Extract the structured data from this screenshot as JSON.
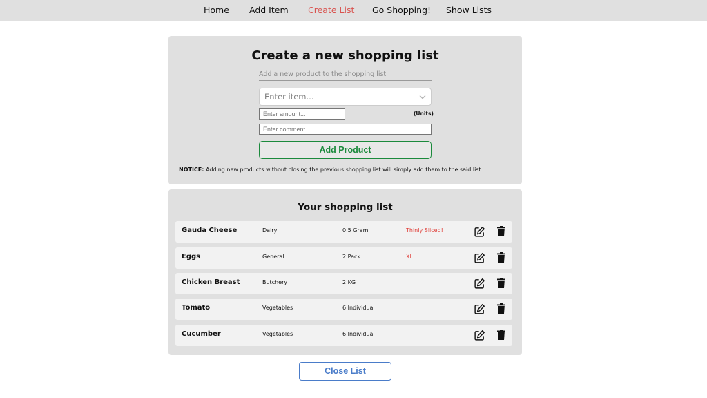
{
  "nav": {
    "items": [
      {
        "label": "Home"
      },
      {
        "label": "Add Item"
      },
      {
        "label": "Create List",
        "active": true
      },
      {
        "label": "Go Shopping!"
      },
      {
        "label": "Show Lists"
      }
    ]
  },
  "form": {
    "title": "Create a new shopping list",
    "subtitle": "Add a new product to the shopping list",
    "item_placeholder": "Enter item...",
    "amount_placeholder": "Enter amount...",
    "units_label": "(Units)",
    "comment_placeholder": "Enter comment...",
    "add_button": "Add Product",
    "notice_label": "NOTICE:",
    "notice_text": " Adding new products without closing the previous shopping list will simply add them to the said list."
  },
  "list": {
    "title": "Your shopping list",
    "rows": [
      {
        "name": "Gauda Cheese",
        "category": "Dairy",
        "quantity": "0.5 Gram",
        "comment": "Thinly Sliced!"
      },
      {
        "name": "Eggs",
        "category": "General",
        "quantity": "2 Pack",
        "comment": "XL"
      },
      {
        "name": "Chicken Breast",
        "category": "Butchery",
        "quantity": "2 KG",
        "comment": ""
      },
      {
        "name": "Tomato",
        "category": "Vegetables",
        "quantity": "6 Individual",
        "comment": ""
      },
      {
        "name": "Cucumber",
        "category": "Vegetables",
        "quantity": "6 Individual",
        "comment": ""
      }
    ]
  },
  "close_button": "Close List",
  "colors": {
    "nav_active": "#d9534f",
    "add_button": "#1b8a3c",
    "close_button": "#4a7cc9",
    "comment_text": "#e0413b"
  },
  "icons": {
    "edit": "edit-icon",
    "delete": "trash-icon",
    "dropdown": "chevron-down-icon"
  }
}
